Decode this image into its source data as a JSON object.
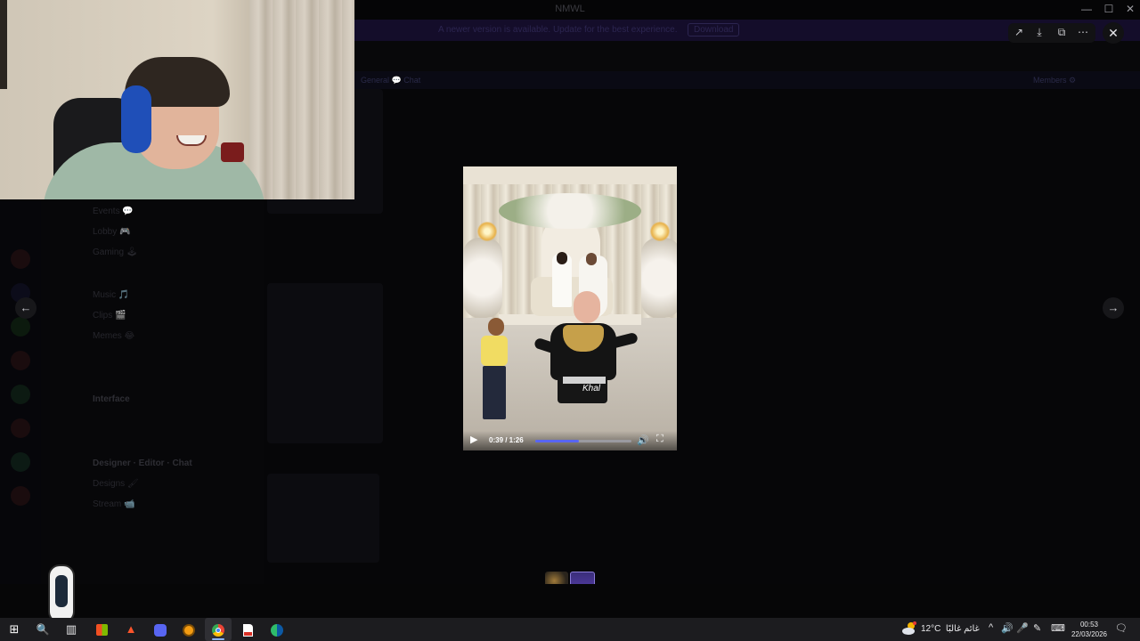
{
  "app": {
    "title": "NMWL"
  },
  "window_controls": {
    "minimize": "—",
    "maximize": "☐",
    "close": "✕"
  },
  "banner": {
    "text": "A newer version is available. Update for the best experience.",
    "button": "Download"
  },
  "channel_header": {
    "left": "General 💬 Chat",
    "right": "Members ⚙"
  },
  "channels": [
    {
      "label": "Events 💬"
    },
    {
      "label": "Lobby 🎮"
    },
    {
      "label": "Gaming 🕹"
    },
    {
      "label": "Music 🎵"
    },
    {
      "label": "Clips 🎬"
    },
    {
      "label": "Memes 😂"
    },
    {
      "label": "Interface"
    },
    {
      "label": "Designer · Editor · Chat"
    },
    {
      "label": "Designs 🖌"
    },
    {
      "label": "Stream 📹"
    }
  ],
  "viewer": {
    "tools": {
      "share_icon": "↗",
      "download_icon": "⤓",
      "open_icon": "⧉",
      "more_icon": "⋯"
    },
    "close_icon": "✕",
    "prev_icon": "←",
    "next_icon": "→"
  },
  "video": {
    "overlay_name": "Khal",
    "time": "0:39 / 1:26",
    "progress": 0.453,
    "play_icon": "▶",
    "volume_icon": "🔊",
    "fullscreen_icon": "⛶"
  },
  "taskbar": {
    "start_icon": "⊞",
    "search_icon": "🔍",
    "taskview_icon": "▥",
    "weather": {
      "temp": "12°C",
      "desc": "غائم غالبًا"
    },
    "tray": {
      "chevron": "^",
      "volume": "🔊",
      "mic": "🎤",
      "pen": "✎",
      "keyboard": "⌨"
    },
    "time": "00:53",
    "date": "22/03/2026",
    "notification_icon": "🗨"
  },
  "colors": {
    "accent": "#5865f2",
    "taskbar_bg": "#1c1c1f"
  }
}
